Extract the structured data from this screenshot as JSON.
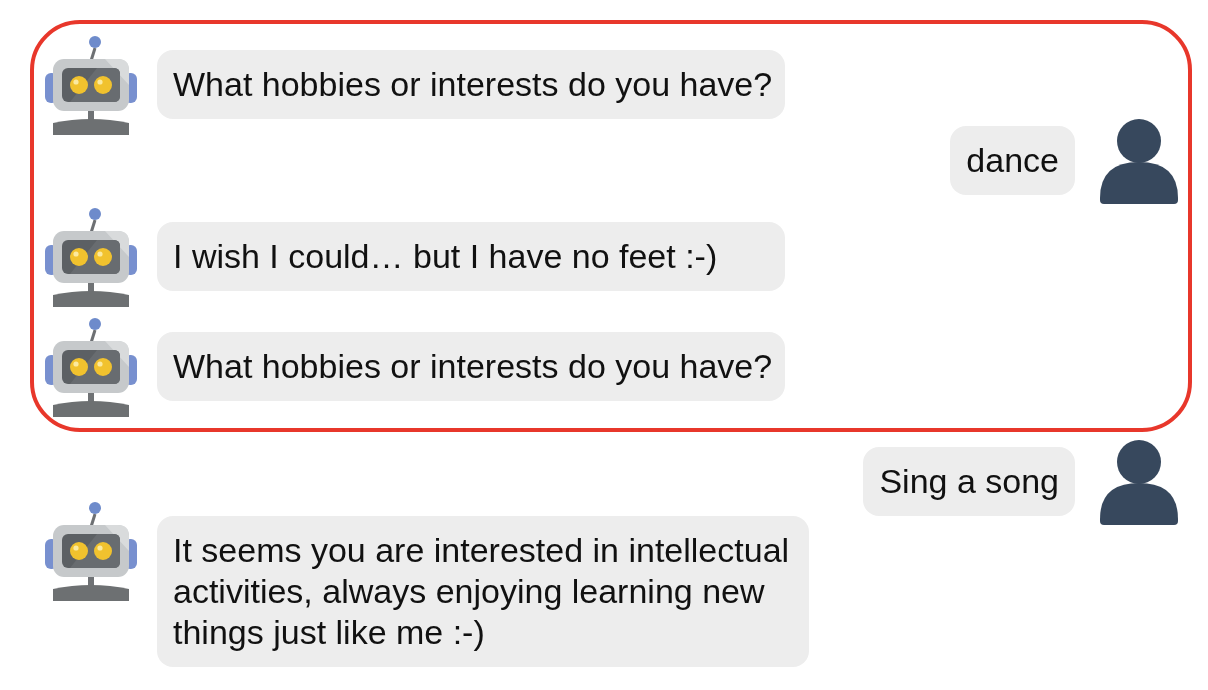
{
  "highlighted_messages": [
    {
      "kind": "bot",
      "text": "What hobbies or interests do you have?"
    },
    {
      "kind": "user",
      "text": "dance"
    },
    {
      "kind": "bot",
      "text": "I wish I could… but I have no feet :-)"
    },
    {
      "kind": "bot",
      "text": "What hobbies or interests do you have?"
    }
  ],
  "messages": [
    {
      "kind": "user",
      "text": "Sing a song"
    },
    {
      "kind": "bot",
      "text": "It seems you are interested in intellectual activities, always enjoying learning new things just like me :-)"
    }
  ]
}
